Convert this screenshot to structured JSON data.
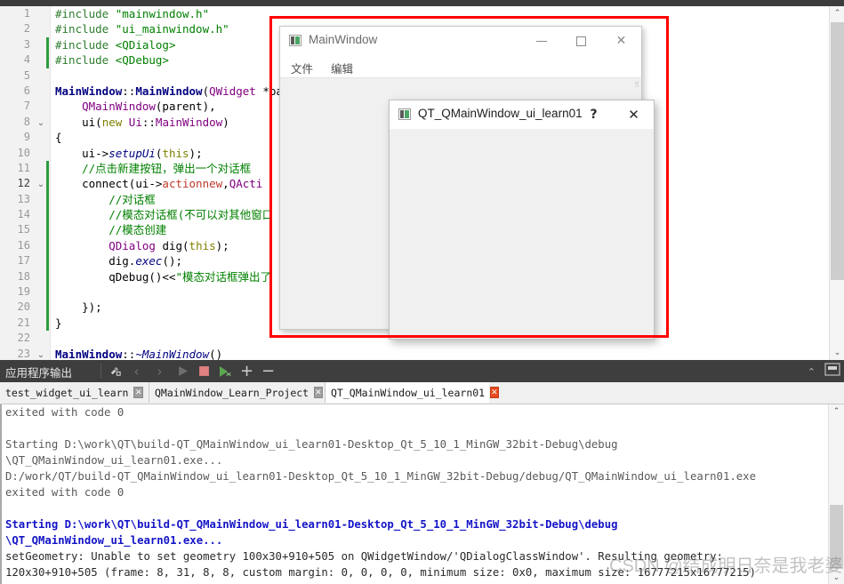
{
  "editor": {
    "lines": [
      {
        "n": "1",
        "fold": "",
        "marker": false,
        "html": "<span class=\"pre\">#include</span> <span class=\"str\">\"mainwindow.h\"</span>"
      },
      {
        "n": "2",
        "fold": "",
        "marker": false,
        "html": "<span class=\"pre\">#include</span> <span class=\"str\">\"ui_mainwindow.h\"</span>"
      },
      {
        "n": "3",
        "fold": "",
        "marker": true,
        "html": "<span class=\"pre\">#include</span> <span class=\"str\">&lt;QDialog&gt;</span>"
      },
      {
        "n": "4",
        "fold": "",
        "marker": true,
        "html": "<span class=\"pre\">#include</span> <span class=\"str\">&lt;QDebug&gt;</span>"
      },
      {
        "n": "5",
        "fold": "",
        "marker": false,
        "html": ""
      },
      {
        "n": "6",
        "fold": "",
        "marker": false,
        "html": "<span class=\"fn\">MainWindow</span><span class=\"pln\">::</span><span class=\"fn\">MainWindow</span><span class=\"pln\">(</span><span class=\"typ\">QWidget</span> <span class=\"pln\">*parent) :</span>"
      },
      {
        "n": "7",
        "fold": "",
        "marker": false,
        "html": "    <span class=\"typ\">QMainWindow</span><span class=\"pln\">(parent),</span>"
      },
      {
        "n": "8",
        "fold": "v",
        "marker": false,
        "html": "    <span class=\"pln\">ui(</span><span class=\"kw\">new</span> <span class=\"typ\">Ui</span><span class=\"pln\">::</span><span class=\"typ\">MainWindow</span><span class=\"pln\">)</span>"
      },
      {
        "n": "9",
        "fold": "",
        "marker": false,
        "html": "<span class=\"pln\">{</span>"
      },
      {
        "n": "10",
        "fold": "",
        "marker": false,
        "html": "    <span class=\"pln\">ui-&gt;</span><span class=\"fni\">setupUi</span><span class=\"pln\">(</span><span class=\"kw\">this</span><span class=\"pln\">);</span>"
      },
      {
        "n": "11",
        "fold": "",
        "marker": true,
        "html": "    <span class=\"cmt\">//点击新建按钮，弹出一个对话框</span>"
      },
      {
        "n": "12",
        "fold": "v",
        "marker": true,
        "html": "    <span class=\"pln\">connect(ui-&gt;</span><span class=\"red\">actionnew</span><span class=\"pln\">,</span><span class=\"typ\">QActi</span>"
      },
      {
        "n": "13",
        "fold": "",
        "marker": true,
        "html": "        <span class=\"cmt\">//对话框</span>"
      },
      {
        "n": "14",
        "fold": "",
        "marker": true,
        "html": "        <span class=\"cmt\">//模态对话框(不可以对其他窗口</span>"
      },
      {
        "n": "15",
        "fold": "",
        "marker": true,
        "html": "        <span class=\"cmt\">//模态创建</span>"
      },
      {
        "n": "16",
        "fold": "",
        "marker": true,
        "html": "        <span class=\"typ\">QDialog</span> <span class=\"pln\">dig(</span><span class=\"kw\">this</span><span class=\"pln\">);</span>"
      },
      {
        "n": "17",
        "fold": "",
        "marker": true,
        "html": "        <span class=\"pln\">dig.</span><span class=\"fni\">exec</span><span class=\"pln\">();</span>"
      },
      {
        "n": "18",
        "fold": "",
        "marker": true,
        "html": "        <span class=\"pln\">qDebug()&lt;&lt;</span><span class=\"str\">\"模态对话框弹出了</span>"
      },
      {
        "n": "19",
        "fold": "",
        "marker": true,
        "html": ""
      },
      {
        "n": "20",
        "fold": "",
        "marker": true,
        "html": "    <span class=\"pln\">});</span>"
      },
      {
        "n": "21",
        "fold": "",
        "marker": true,
        "html": "<span class=\"pln\">}</span>"
      },
      {
        "n": "22",
        "fold": "",
        "marker": false,
        "html": ""
      },
      {
        "n": "23",
        "fold": "v",
        "marker": false,
        "html": "<span class=\"fn\">MainWindow</span><span class=\"pln\">::</span><span class=\"fni\">~MainWindow</span><span class=\"pln\">()</span>"
      }
    ],
    "scrollbar": {
      "up": "⌃",
      "down": "⌄"
    }
  },
  "mainwindow": {
    "title": "MainWindow",
    "icon": "app-icon",
    "buttons": {
      "minimize": "—",
      "maximize": "□",
      "close": "✕"
    },
    "menus": [
      {
        "label": "文件"
      },
      {
        "label": "编辑"
      }
    ]
  },
  "dialog": {
    "title": "QT_QMainWindow_ui_learn01",
    "icon": "app-icon",
    "buttons": {
      "help": "?",
      "close": "✕"
    }
  },
  "output_panel": {
    "title": "应用程序输出",
    "toolbar_icons": [
      {
        "name": "clear-output-icon",
        "glyph": "⚒"
      },
      {
        "name": "previous-item-icon",
        "glyph": "‹"
      },
      {
        "name": "next-item-icon",
        "glyph": "›"
      },
      {
        "name": "run-icon",
        "glyph": "▶"
      },
      {
        "name": "stop-icon",
        "glyph": "■"
      },
      {
        "name": "attach-debugger-icon",
        "glyph": "▶"
      },
      {
        "name": "zoom-in-icon",
        "glyph": "+"
      },
      {
        "name": "zoom-out-icon",
        "glyph": "−"
      }
    ],
    "right_icons": [
      {
        "name": "collapse-pane-icon",
        "glyph": "⌃"
      },
      {
        "name": "maximize-pane-icon",
        "glyph": "⬒"
      }
    ],
    "tabs": [
      {
        "label": "test_widget_ui_learn",
        "active": false,
        "close": "✕",
        "close_style": "grey"
      },
      {
        "label": "QMainWindow_Learn_Project",
        "active": false,
        "close": "✕",
        "close_style": "grey"
      },
      {
        "label": "QT_QMainWindow_ui_learn01",
        "active": true,
        "close": "✕",
        "close_style": "red"
      }
    ],
    "console_lines": [
      {
        "text": "exited with code 0",
        "style": "grey"
      },
      {
        "text": "",
        "style": "grey"
      },
      {
        "text": "Starting D:\\work\\QT\\build-QT_QMainWindow_ui_learn01-Desktop_Qt_5_10_1_MinGW_32bit-Debug\\debug",
        "style": "grey"
      },
      {
        "text": "\\QT_QMainWindow_ui_learn01.exe...",
        "style": "grey"
      },
      {
        "text": "D:/work/QT/build-QT_QMainWindow_ui_learn01-Desktop_Qt_5_10_1_MinGW_32bit-Debug/debug/QT_QMainWindow_ui_learn01.exe",
        "style": "grey"
      },
      {
        "text": "exited with code 0",
        "style": "grey"
      },
      {
        "text": "",
        "style": "grey"
      },
      {
        "text": "Starting D:\\work\\QT\\build-QT_QMainWindow_ui_learn01-Desktop_Qt_5_10_1_MinGW_32bit-Debug\\debug",
        "style": "blue"
      },
      {
        "text": "\\QT_QMainWindow_ui_learn01.exe...",
        "style": "blue"
      },
      {
        "text": "setGeometry: Unable to set geometry 100x30+910+505 on QWidgetWindow/'QDialogClassWindow'. Resulting geometry:",
        "style": "dark"
      },
      {
        "text": "120x30+910+505 (frame: 8, 31, 8, 8, custom margin: 0, 0, 0, 0, minimum size: 0x0, maximum size: 16777215x16777215)",
        "style": "dark"
      }
    ],
    "scrollbar": {
      "up": "⌃",
      "down": "⌄"
    }
  },
  "watermark": {
    "text": "CSDN @结成明日奈是我老婆"
  },
  "colors": {
    "accent_red": "#ff0000",
    "toolbar_bg": "#3e3e3e",
    "console_blue": "#1414c8",
    "tab_close_red": "#e8491d",
    "stop_red": "#e08080",
    "run_green": "#5aa84f"
  }
}
